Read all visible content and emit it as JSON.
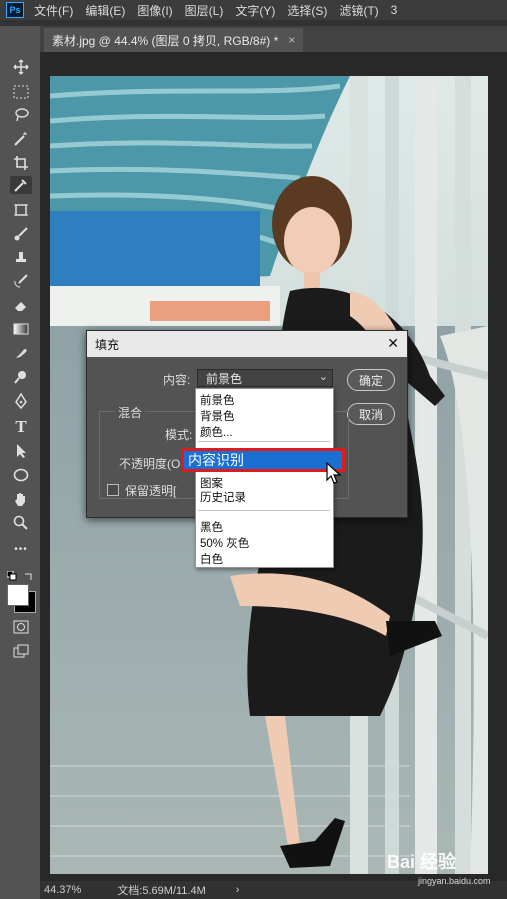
{
  "app": {
    "logo": "Ps"
  },
  "menubar": {
    "items": [
      "文件(F)",
      "编辑(E)",
      "图像(I)",
      "图层(L)",
      "文字(Y)",
      "选择(S)",
      "滤镜(T)",
      "3"
    ]
  },
  "tab": {
    "title": "素材.jpg @ 44.4% (图层 0 拷贝, RGB/8#) *",
    "close": "×"
  },
  "toolbar": {
    "tools": [
      "move-tool-icon",
      "marquee-tool-icon",
      "lasso-tool-icon",
      "magic-wand-icon",
      "crop-tool-icon",
      "eyedropper-icon",
      "frame-tool-icon",
      "brush-tool-icon",
      "stamp-tool-icon",
      "history-brush-icon",
      "eraser-icon",
      "gradient-icon",
      "smudge-icon",
      "dodge-icon",
      "pen-tool-icon",
      "type-tool-icon",
      "path-select-icon",
      "ellipse-tool-icon",
      "hand-tool-icon",
      "zoom-tool-icon",
      "more-tools-icon"
    ],
    "type_glyph": "T",
    "more_glyph": "•••"
  },
  "dialog": {
    "title": "填充",
    "close": "✕",
    "content_label": "内容:",
    "content_value": "前景色",
    "ok_label": "确定",
    "cancel_label": "取消",
    "blend_group": "混合",
    "mode_label": "模式:",
    "opacity_label": "不透明度(O",
    "preserve_label": "保留透明[",
    "dropdown_caret": "⌄"
  },
  "dropdown": {
    "items_top": [
      "前景色",
      "背景色",
      "颜色..."
    ],
    "highlighted": "内容识别",
    "items_mid": [
      "图案",
      "历史记录"
    ],
    "items_bottom": [
      "黑色",
      "50% 灰色",
      "白色"
    ]
  },
  "status": {
    "zoom": "44.37%",
    "doc_info": "文档:5.69M/11.4M",
    "arrow": "›"
  },
  "watermark": {
    "brand": "Bai 经验",
    "url": "jingyan.baidu.com"
  },
  "colors": {
    "accent": "#1a6fd3",
    "highlight_border": "#e01b1b",
    "panel": "#535353"
  }
}
